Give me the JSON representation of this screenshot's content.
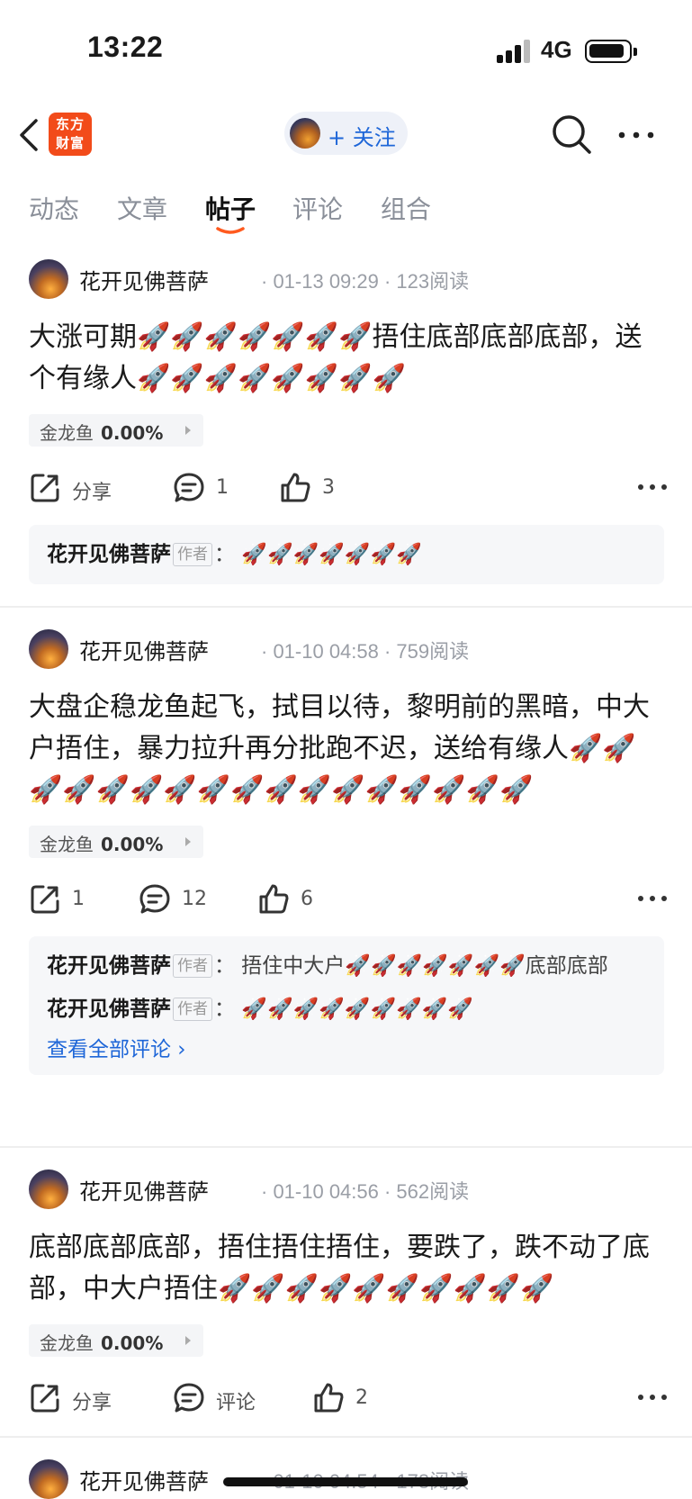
{
  "status": {
    "time": "13:22",
    "network": "4G"
  },
  "nav": {
    "logo_text": "东方\n财富",
    "follow_label": "+ 关注"
  },
  "tabs": [
    "动态",
    "文章",
    "帖子",
    "评论",
    "组合"
  ],
  "active_tab": "帖子",
  "posts": [
    {
      "author": "花开见佛菩萨",
      "meta": "· 01-13 09:29 · 123阅读",
      "body": "大涨可期🚀🚀🚀🚀🚀🚀🚀捂住底部底部底部，送个有缘人🚀🚀🚀🚀🚀🚀🚀🚀",
      "stock": {
        "name": "金龙鱼",
        "change": "0.00%"
      },
      "actions": {
        "share": "分享",
        "comment": "1",
        "like": "3"
      },
      "comments": [
        {
          "name": "花开见佛菩萨",
          "badge": "作者",
          "text": "：  🚀🚀🚀🚀🚀🚀🚀"
        }
      ]
    },
    {
      "author": "花开见佛菩萨",
      "meta": "· 01-10 04:58 · 759阅读",
      "body": "大盘企稳龙鱼起飞，拭目以待，黎明前的黑暗，中大户捂住，暴力拉升再分批跑不迟，送给有缘人🚀🚀🚀🚀🚀🚀🚀🚀🚀🚀🚀🚀🚀🚀🚀🚀🚀",
      "stock": {
        "name": "金龙鱼",
        "change": "0.00%"
      },
      "actions": {
        "share": "1",
        "comment": "12",
        "like": "6"
      },
      "comments": [
        {
          "name": "花开见佛菩萨",
          "badge": "作者",
          "text": "：  捂住中大户🚀🚀🚀🚀🚀🚀🚀底部底部"
        },
        {
          "name": "花开见佛菩萨",
          "badge": "作者",
          "text": "：  🚀🚀🚀🚀🚀🚀🚀🚀🚀"
        }
      ],
      "view_all": "查看全部评论 ›"
    },
    {
      "author": "花开见佛菩萨",
      "meta": "· 01-10 04:56 · 562阅读",
      "body": "底部底部底部，捂住捂住捂住，要跌了，跌不动了底部，中大户捂住🚀🚀🚀🚀🚀🚀🚀🚀🚀🚀",
      "stock": {
        "name": "金龙鱼",
        "change": "0.00%"
      },
      "actions": {
        "share": "分享",
        "comment": "评论",
        "like": "2"
      }
    },
    {
      "author": "花开见佛菩萨",
      "meta": "· 01-10 04:54 · 178阅读"
    }
  ],
  "colors": {
    "accent": "#1e66d8",
    "brand": "#f24b1a",
    "tab_underline": "#ff5a1f"
  }
}
